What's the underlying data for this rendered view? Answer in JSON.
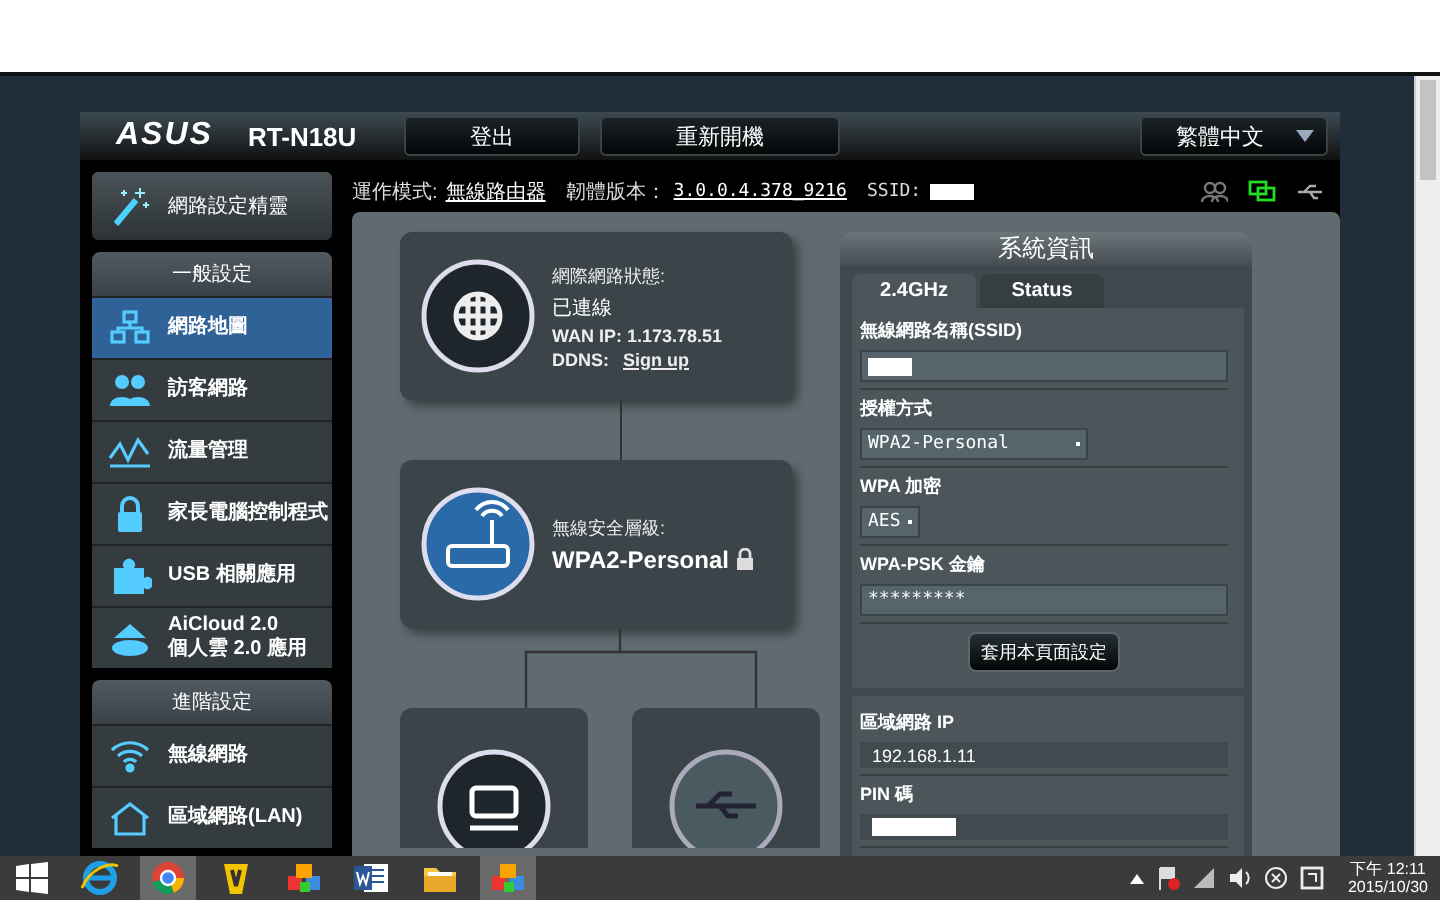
{
  "header": {
    "logo": "ASUS",
    "model": "RT-N18U",
    "buttons": [
      "登出",
      "重新開機"
    ],
    "language": "繁體中文"
  },
  "info_bar": {
    "mode_label": "運作模式:",
    "mode": "無線路由器",
    "firmware_label": "韌體版本：",
    "firmware": "3.0.0.4.378_9216",
    "ssid_label": "SSID:"
  },
  "sidebar": {
    "wizard": "網路設定精靈",
    "sections": [
      {
        "title": "一般設定",
        "items": [
          {
            "kind": "map",
            "lines": [
              "網路地圖"
            ],
            "selected": true
          },
          {
            "kind": "guest",
            "lines": [
              "訪客網路"
            ],
            "selected": false
          },
          {
            "kind": "traffic",
            "lines": [
              "流量管理"
            ],
            "selected": false
          },
          {
            "kind": "parental",
            "lines": [
              "家長電腦控制程式"
            ],
            "selected": false
          },
          {
            "kind": "usb",
            "lines": [
              "USB 相關應用"
            ],
            "selected": false
          },
          {
            "kind": "cloud",
            "lines": [
              "AiCloud 2.0",
              "個人雲 2.0 應用"
            ],
            "selected": false
          }
        ]
      },
      {
        "title": "進階設定",
        "items": [
          {
            "kind": "wifi",
            "lines": [
              "無線網路"
            ],
            "selected": false
          },
          {
            "kind": "lan",
            "lines": [
              "區域網路(LAN)"
            ],
            "selected": false
          }
        ]
      }
    ]
  },
  "network_map": {
    "internet": {
      "status_label": "網際網路狀態:",
      "status": "已連線",
      "wan_ip_label": "WAN IP:",
      "wan_ip": "1.173.78.51",
      "ddns_label": "DDNS:",
      "ddns_link": "Sign up"
    },
    "router": {
      "security_label": "無線安全層級:",
      "security": "WPA2-Personal"
    }
  },
  "system_info": {
    "title": "系統資訊",
    "tabs": [
      {
        "label": "2.4GHz",
        "selected": true
      },
      {
        "label": "Status",
        "selected": false
      }
    ],
    "fields": [
      {
        "kind": "input",
        "label": "無線網路名稱(SSID)",
        "redacted": true
      },
      {
        "kind": "select",
        "label": "授權方式",
        "value": "WPA2-Personal"
      },
      {
        "kind": "select",
        "label": "WPA 加密",
        "value": "AES"
      },
      {
        "kind": "input",
        "label": "WPA-PSK 金鑰",
        "value": "*********"
      }
    ],
    "apply_button": "套用本頁面設定",
    "lan_fields": [
      {
        "kind": "text",
        "label": "區域網路 IP",
        "value": "192.168.1.11"
      },
      {
        "kind": "text",
        "label": "PIN 碼",
        "redacted": true
      }
    ]
  },
  "taskbar": {
    "apps": [
      {
        "kind": "ie",
        "selected": false
      },
      {
        "kind": "chrome",
        "selected": true
      },
      {
        "kind": "yellow",
        "selected": false
      },
      {
        "kind": "cubes",
        "selected": false
      },
      {
        "kind": "word",
        "selected": false
      },
      {
        "kind": "folder",
        "selected": false
      },
      {
        "kind": "cubes",
        "selected": true
      }
    ],
    "time": "下午 12:11",
    "date": "2015/10/30"
  }
}
